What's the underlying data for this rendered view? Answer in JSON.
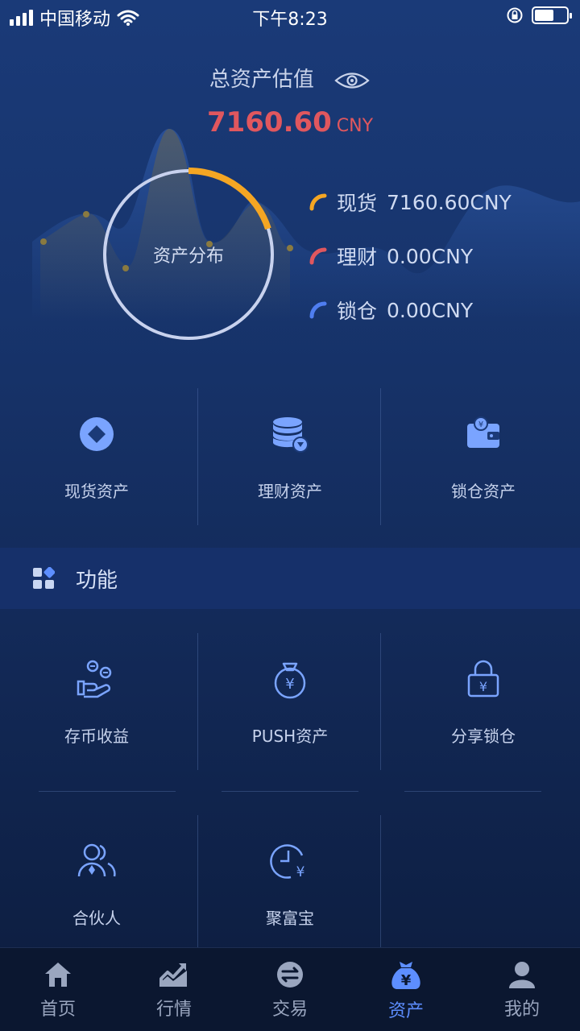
{
  "status_bar": {
    "carrier": "中国移动",
    "time": "下午8:23",
    "battery_level": 0.6
  },
  "summary": {
    "title": "总资产估值",
    "value": "7160.60",
    "unit": "CNY"
  },
  "distribution": {
    "center_label": "资产分布",
    "items": [
      {
        "name": "现货",
        "value": "7160.60CNY",
        "color": "#f5a623",
        "share": 0.2
      },
      {
        "name": "理财",
        "value": "0.00CNY",
        "color": "#e0575e",
        "share": 0
      },
      {
        "name": "锁仓",
        "value": "0.00CNY",
        "color": "#4f7ef0",
        "share": 0
      }
    ]
  },
  "asset_types": [
    {
      "label": "现货资产",
      "icon": "diamond-coin-icon"
    },
    {
      "label": "理财资产",
      "icon": "coin-stack-icon"
    },
    {
      "label": "锁仓资产",
      "icon": "wallet-icon"
    }
  ],
  "functions_section": {
    "title": "功能"
  },
  "functions": [
    {
      "label": "存币收益",
      "icon": "hand-coins-icon"
    },
    {
      "label": "PUSH资产",
      "icon": "money-bag-icon"
    },
    {
      "label": "分享锁仓",
      "icon": "lock-yen-icon"
    },
    {
      "label": "合伙人",
      "icon": "partners-icon"
    },
    {
      "label": "聚富宝",
      "icon": "clock-yen-icon"
    }
  ],
  "tabs": [
    {
      "label": "首页",
      "icon": "home-icon",
      "active": false
    },
    {
      "label": "行情",
      "icon": "chart-icon",
      "active": false
    },
    {
      "label": "交易",
      "icon": "exchange-icon",
      "active": false
    },
    {
      "label": "资产",
      "icon": "yen-bag-icon",
      "active": true
    },
    {
      "label": "我的",
      "icon": "user-icon",
      "active": false
    }
  ],
  "colors": {
    "accent": "#5d8eff",
    "value_red": "#e0575e",
    "ring": "#c8d2ee",
    "icon_blue": "#7aa4ff"
  }
}
